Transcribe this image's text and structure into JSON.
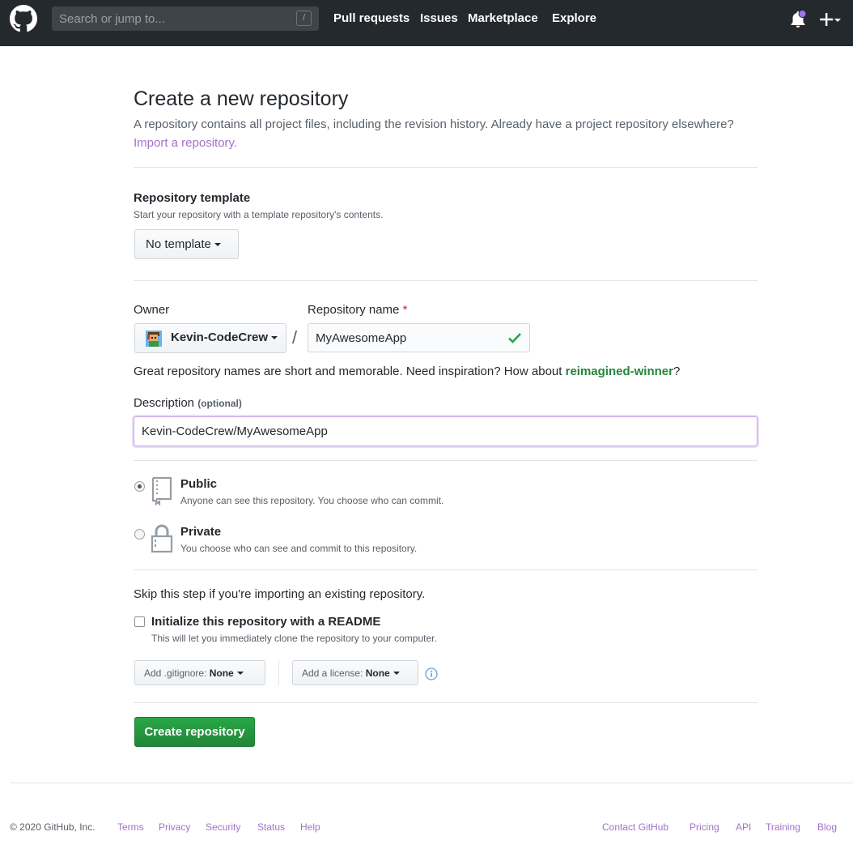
{
  "header": {
    "search_placeholder": "Search or jump to...",
    "search_shortcut": "/",
    "nav": [
      "Pull requests",
      "Issues",
      "Marketplace",
      "Explore"
    ]
  },
  "main": {
    "title": "Create a new repository",
    "subtitle": "A repository contains all project files, including the revision history. Already have a project repository elsewhere?",
    "import_link": "Import a repository.",
    "template": {
      "label": "Repository template",
      "note": "Start your repository with a template repository's contents.",
      "button": "No template"
    },
    "owner": {
      "label": "Owner",
      "value": "Kevin-CodeCrew"
    },
    "repo_name": {
      "label": "Repository name",
      "required_mark": "*",
      "value": "MyAwesomeApp"
    },
    "separator": "/",
    "hint": {
      "text": "Great repository names are short and memorable. Need inspiration? How about ",
      "suggestion": "reimagined-winner",
      "suffix": "?"
    },
    "description": {
      "label": "Description",
      "optional": "(optional)",
      "value": "Kevin-CodeCrew/MyAwesomeApp"
    },
    "visibility": {
      "public_title": "Public",
      "public_desc": "Anyone can see this repository. You choose who can commit.",
      "private_title": "Private",
      "private_desc": "You choose who can see and commit to this repository.",
      "selected": "Public"
    },
    "init": {
      "skip_note": "Skip this step if you're importing an existing repository.",
      "readme_label": "Initialize this repository with a README",
      "readme_desc": "This will let you immediately clone the repository to your computer.",
      "readme_checked": false
    },
    "gitignore": {
      "prefix": "Add .gitignore: ",
      "value": "None"
    },
    "license": {
      "prefix": "Add a license: ",
      "value": "None"
    },
    "create_button": "Create repository"
  },
  "footer": {
    "copyright": "© 2020 GitHub, Inc.",
    "left_links": [
      "Terms",
      "Privacy",
      "Security",
      "Status",
      "Help"
    ],
    "right_links": [
      "Contact GitHub",
      "Pricing",
      "API",
      "Training",
      "Blog"
    ]
  },
  "colors": {
    "header_bg": "#24292e",
    "link": "#a371c9",
    "success": "#28a745",
    "notification_dot": "#a371f7"
  },
  "icons": [
    "github-logo-icon",
    "bell-icon",
    "plus-icon",
    "chevron-down-icon",
    "check-icon",
    "repo-book-icon",
    "lock-icon",
    "info-icon"
  ]
}
